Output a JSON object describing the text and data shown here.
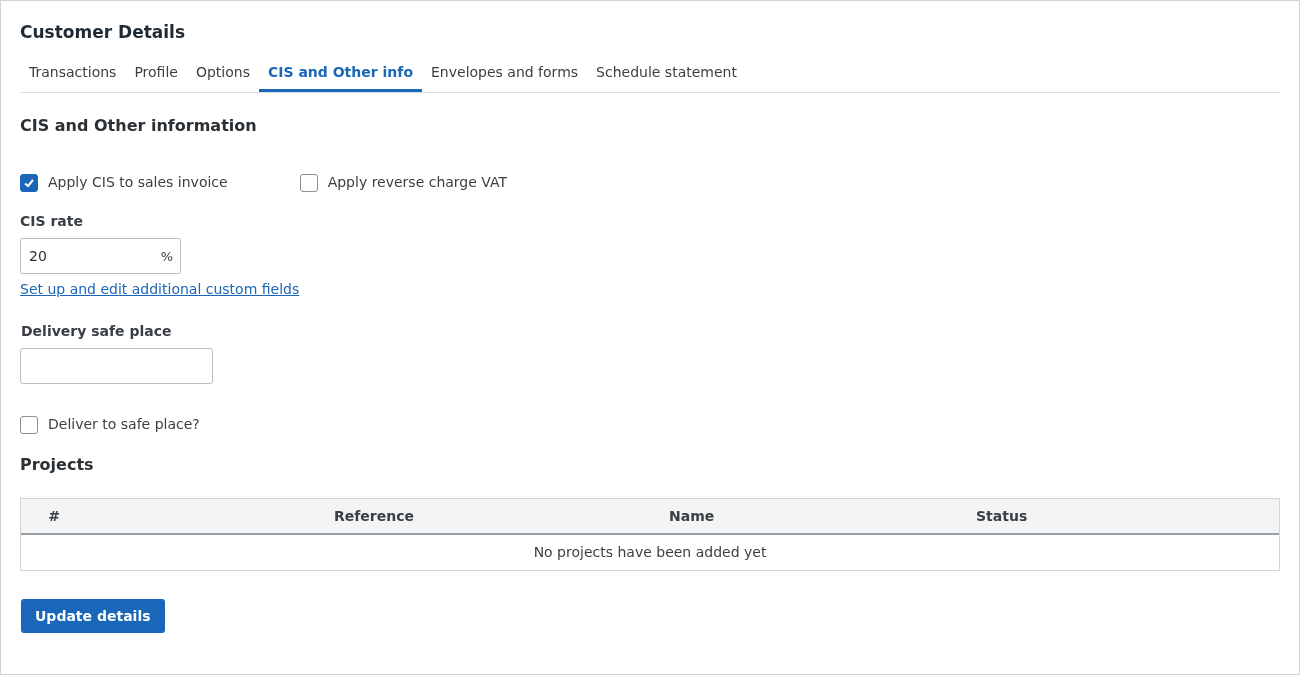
{
  "title": "Customer Details",
  "tabs": [
    {
      "label": "Transactions",
      "selected": false
    },
    {
      "label": "Profile",
      "selected": false
    },
    {
      "label": "Options",
      "selected": false
    },
    {
      "label": "CIS and Other info",
      "selected": true
    },
    {
      "label": "Envelopes and forms",
      "selected": false
    },
    {
      "label": "Schedule statement",
      "selected": false
    }
  ],
  "section_title": "CIS and Other information",
  "cis_checkboxes": [
    {
      "label": "Apply CIS to sales invoice",
      "checked": true
    },
    {
      "label": "Apply reverse charge VAT",
      "checked": false
    }
  ],
  "cis_rate": {
    "label": "CIS rate",
    "value": "20",
    "suffix": "%"
  },
  "custom_fields_link": "Set up and edit additional custom fields",
  "delivery_safe_place": {
    "label": "Delivery safe place"
  },
  "deliver_checkbox": {
    "label": "Deliver to safe place?",
    "checked": false
  },
  "projects": {
    "title": "Projects",
    "columns": [
      "#",
      "Reference",
      "Name",
      "Status"
    ],
    "empty_message": "No projects have been added yet"
  },
  "button": "Update details"
}
